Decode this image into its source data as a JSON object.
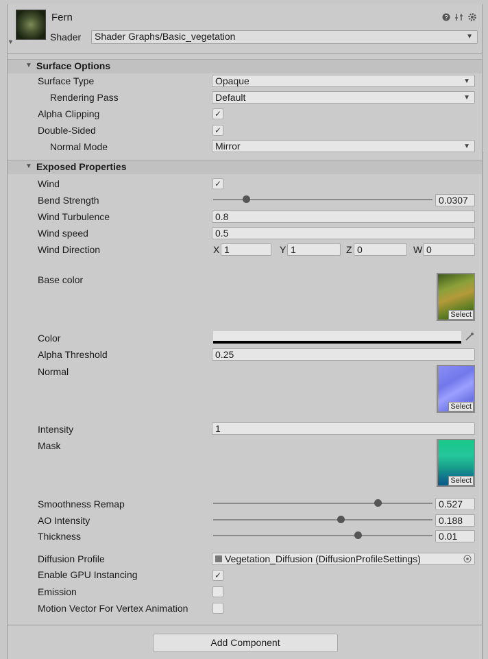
{
  "header": {
    "name": "Fern",
    "shader_label": "Shader",
    "shader_value": "Shader Graphs/Basic_vegetation",
    "icons": [
      "help-icon",
      "preset-icon",
      "settings-icon"
    ]
  },
  "surface_options": {
    "title": "Surface Options",
    "surface_type_label": "Surface Type",
    "surface_type_value": "Opaque",
    "rendering_pass_label": "Rendering Pass",
    "rendering_pass_value": "Default",
    "alpha_clipping_label": "Alpha Clipping",
    "alpha_clipping": true,
    "double_sided_label": "Double-Sided",
    "double_sided": true,
    "normal_mode_label": "Normal Mode",
    "normal_mode_value": "Mirror"
  },
  "exposed": {
    "title": "Exposed Properties",
    "wind_label": "Wind",
    "wind": true,
    "bend_strength_label": "Bend Strength",
    "bend_strength_value": "0.0307",
    "bend_strength_fraction": 0.15,
    "wind_turbulence_label": "Wind Turbulence",
    "wind_turbulence_value": "0.8",
    "wind_speed_label": "Wind speed",
    "wind_speed_value": "0.5",
    "wind_direction_label": "Wind Direction",
    "wind_direction": {
      "x_label": "X",
      "x": "1",
      "y_label": "Y",
      "y": "1",
      "z_label": "Z",
      "z": "0",
      "w_label": "W",
      "w": "0"
    },
    "base_color_label": "Base color",
    "color_label": "Color",
    "alpha_threshold_label": "Alpha Threshold",
    "alpha_threshold_value": "0.25",
    "normal_label": "Normal",
    "intensity_label": "Intensity",
    "intensity_value": "1",
    "mask_label": "Mask",
    "select_label": "Select",
    "smoothness_label": "Smoothness Remap",
    "smoothness_value": "0.527",
    "smoothness_fraction": 0.75,
    "ao_label": "AO Intensity",
    "ao_value": "0.188",
    "ao_fraction": 0.58,
    "thickness_label": "Thickness",
    "thickness_value": "0.01",
    "thickness_fraction": 0.66,
    "diffusion_label": "Diffusion Profile",
    "diffusion_value": "Vegetation_Diffusion (DiffusionProfileSettings)",
    "gpu_instancing_label": "Enable GPU Instancing",
    "gpu_instancing": true,
    "emission_label": "Emission",
    "emission": false,
    "motion_vector_label": "Motion Vector For Vertex Animation",
    "motion_vector": false
  },
  "add_component_label": "Add Component",
  "colors": {
    "base_color_tex": "#6c8a2e",
    "normal_tex": "#7f86f0",
    "mask_tex": "#1fae8a"
  }
}
